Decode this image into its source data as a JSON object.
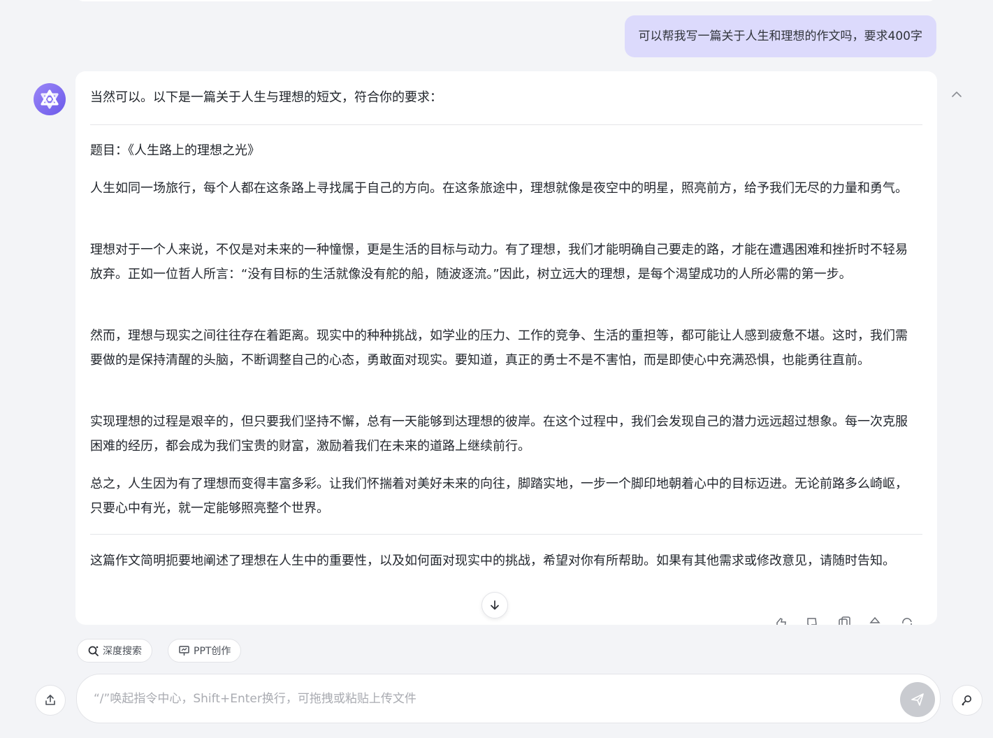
{
  "conversation": {
    "user_message": "可以帮我写一篇关于人生和理想的作文吗，要求400字",
    "assistant": {
      "intro": "当然可以。以下是一篇关于人生与理想的短文，符合你的要求：",
      "essay_title": "题目：《人生路上的理想之光》",
      "paragraphs": [
        "人生如同一场旅行，每个人都在这条路上寻找属于自己的方向。在这条旅途中，理想就像是夜空中的明星，照亮前方，给予我们无尽的力量和勇气。",
        "理想对于一个人来说，不仅是对未来的一种憧憬，更是生活的目标与动力。有了理想，我们才能明确自己要走的路，才能在遭遇困难和挫折时不轻易放弃。正如一位哲人所言：“没有目标的生活就像没有舵的船，随波逐流。”因此，树立远大的理想，是每个渴望成功的人所必需的第一步。",
        "然而，理想与现实之间往往存在着距离。现实中的种种挑战，如学业的压力、工作的竞争、生活的重担等，都可能让人感到疲惫不堪。这时，我们需要做的是保持清醒的头脑，不断调整自己的心态，勇敢面对现实。要知道，真正的勇士不是不害怕，而是即使心中充满恐惧，也能勇往直前。",
        "实现理想的过程是艰辛的，但只要我们坚持不懈，总有一天能够到达理想的彼岸。在这个过程中，我们会发现自己的潜力远远超过想象。每一次克服困难的经历，都会成为我们宝贵的财富，激励着我们在未来的道路上继续前行。",
        "总之，人生因为有了理想而变得丰富多彩。让我们怀揣着对美好未来的向往，脚踏实地，一步一个脚印地朝着心中的目标迈进。无论前路多么崎岖，只要心中有光，就一定能够照亮整个世界。"
      ],
      "closing": "这篇作文简明扼要地阐述了理想在人生中的重要性，以及如何面对现实中的挑战，希望对你有所帮助。如果有其他需求或修改意见，请随时告知。"
    }
  },
  "toolbar": {
    "deep_search_label": "深度搜索",
    "ppt_label": "PPT创作"
  },
  "composer": {
    "placeholder": "“/”唤起指令中心，Shift+Enter换行，可拖拽或粘贴上传文件"
  },
  "icons": {
    "avatar": "assistant-logo-icon",
    "collapse": "chevron-up-icon",
    "scroll_down": "arrow-down-icon",
    "upload": "upload-icon",
    "send": "send-icon",
    "tools": "tools-icon",
    "deep_search": "search-icon",
    "ppt": "presentation-icon"
  },
  "colors": {
    "user_bubble": "#dcdafc",
    "avatar_gradient_start": "#9a86f7",
    "avatar_gradient_end": "#6b59ea",
    "send_disabled": "#c9cbd0",
    "page_background": "#f3f4f7"
  }
}
